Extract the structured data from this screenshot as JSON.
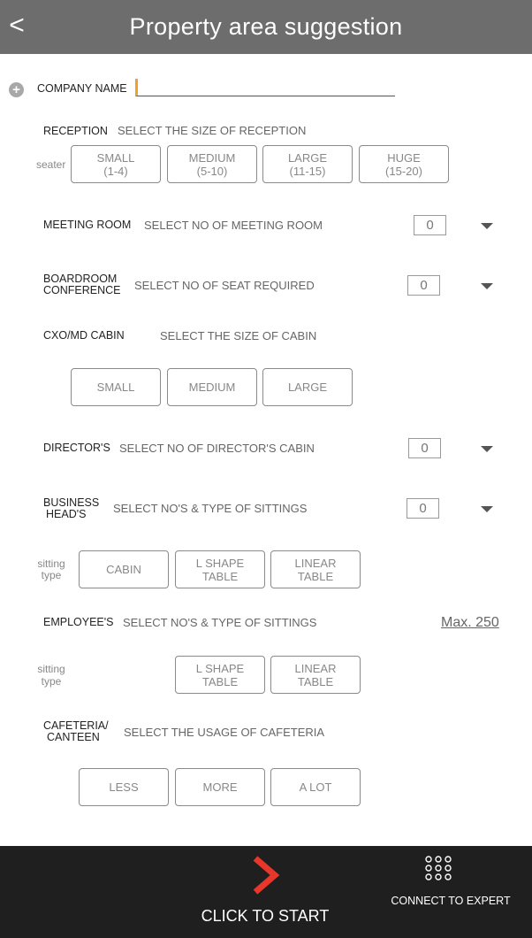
{
  "header": {
    "title": "Property area suggestion",
    "back_glyph": "<"
  },
  "company": {
    "label": "COMPANY NAME",
    "value": ""
  },
  "reception": {
    "label": "RECEPTION",
    "prompt": "SELECT THE SIZE OF RECEPTION",
    "side_label": "seater",
    "options": [
      {
        "line1": "SMALL",
        "line2": "(1-4)"
      },
      {
        "line1": "MEDIUM",
        "line2": "(5-10)"
      },
      {
        "line1": "LARGE",
        "line2": "(11-15)"
      },
      {
        "line1": "HUGE",
        "line2": "(15-20)"
      }
    ]
  },
  "meeting_room": {
    "label": "MEETING ROOM",
    "prompt": "SELECT NO OF MEETING ROOM",
    "value": "0"
  },
  "boardroom": {
    "label_line1": "BOARDROOM",
    "label_line2": "CONFERENCE",
    "prompt": "SELECT NO OF SEAT REQUIRED",
    "value": "0"
  },
  "cabin": {
    "label": "CXO/MD  CABIN",
    "prompt": "SELECT THE SIZE OF CABIN",
    "options": [
      "SMALL",
      "MEDIUM",
      "LARGE"
    ]
  },
  "directors": {
    "label": "DIRECTOR'S",
    "prompt": "SELECT NO OF DIRECTOR'S CABIN",
    "value": "0"
  },
  "business_heads": {
    "label_line1": "BUSINESS",
    "label_line2": "HEAD'S",
    "prompt": "SELECT NO'S & TYPE OF SITTINGS",
    "value": "0",
    "side_label_line1": "sitting",
    "side_label_line2": "type",
    "options": [
      {
        "line1": "CABIN",
        "line2": ""
      },
      {
        "line1": "L SHAPE",
        "line2": "TABLE"
      },
      {
        "line1": "LINEAR",
        "line2": "TABLE"
      }
    ]
  },
  "employees": {
    "label": "EMPLOYEE'S",
    "prompt": "SELECT NO'S & TYPE OF SITTINGS",
    "max": "Max. 250",
    "side_label_line1": "sitting",
    "side_label_line2": "type",
    "options": [
      {
        "line1": "L SHAPE",
        "line2": "TABLE"
      },
      {
        "line1": "LINEAR",
        "line2": "TABLE"
      }
    ]
  },
  "cafeteria": {
    "label_line1": "CAFETERIA/",
    "label_line2": "CANTEEN",
    "prompt": "SELECT THE USAGE OF CAFETERIA",
    "options": [
      "LESS",
      "MORE",
      "A LOT"
    ]
  },
  "footer": {
    "start_label": "CLICK TO START",
    "expert_label": "CONNECT TO EXPERT",
    "colors": {
      "accent": "#e8372a",
      "bar": "#1f1f1f"
    }
  },
  "icons": {
    "back": "back-arrow-icon",
    "add": "plus-circle-icon",
    "dropdown": "caret-down-icon",
    "start": "chevron-right-icon",
    "expert": "dial-grid-icon"
  }
}
